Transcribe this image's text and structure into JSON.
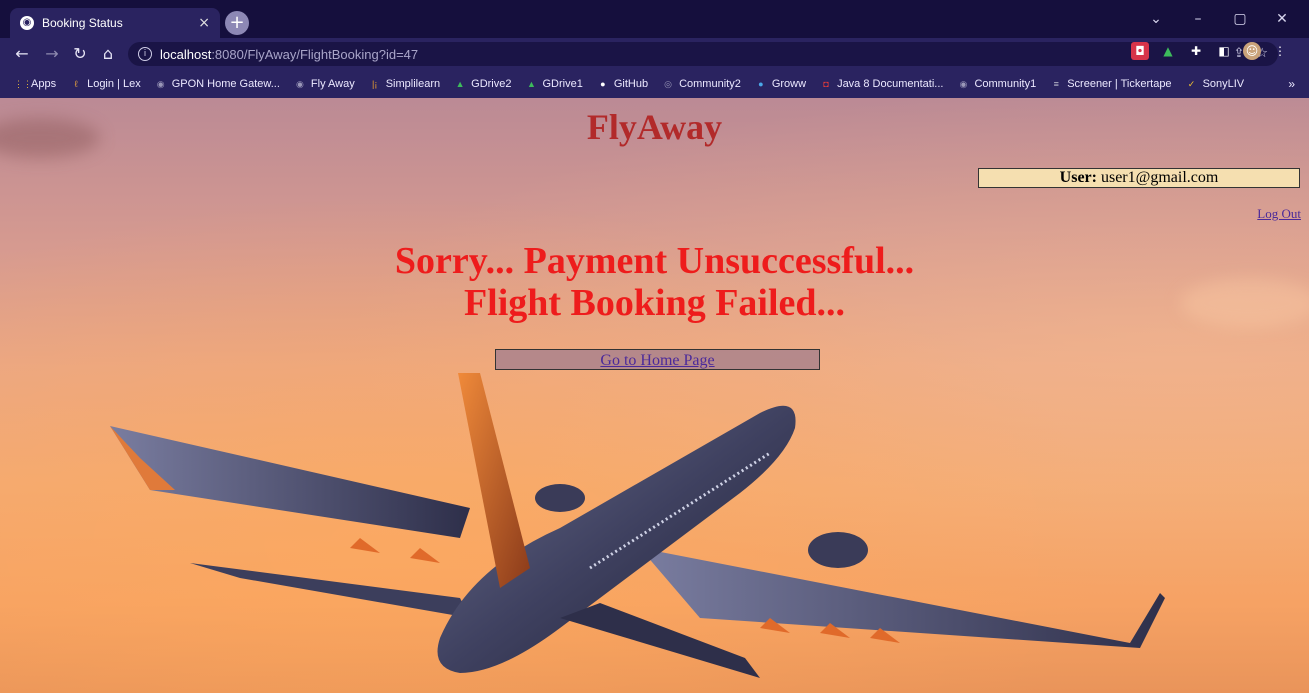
{
  "browser": {
    "tab_title": "Booking Status",
    "tab_close": "×",
    "new_tab": "+",
    "url_host": "localhost",
    "url_rest": ":8080/FlyAway/FlightBooking?id=47",
    "window_controls": [
      "⌄",
      "–",
      "▢",
      "✕"
    ],
    "bookmarks": [
      {
        "label": "Apps",
        "icon": "apps-grid-icon",
        "color": "#e8b93c"
      },
      {
        "label": "Login | Lex",
        "icon": "lex-icon",
        "color": "#e8a23c"
      },
      {
        "label": "GPON Home Gatew...",
        "icon": "globe-icon",
        "color": "#9a97b8"
      },
      {
        "label": "Fly Away",
        "icon": "globe-icon",
        "color": "#9a97b8"
      },
      {
        "label": "Simplilearn",
        "icon": "simplilearn-icon",
        "color": "#f0a02c"
      },
      {
        "label": "GDrive2",
        "icon": "gdrive-icon",
        "color": "#3dbb5c"
      },
      {
        "label": "GDrive1",
        "icon": "gdrive-icon",
        "color": "#3dbb5c"
      },
      {
        "label": "GitHub",
        "icon": "github-icon",
        "color": "#ffffff"
      },
      {
        "label": "Community2",
        "icon": "community-icon",
        "color": "#9a97b8"
      },
      {
        "label": "Groww",
        "icon": "groww-icon",
        "color": "#4aa8e8"
      },
      {
        "label": "Java 8 Documentati...",
        "icon": "java-doc-icon",
        "color": "#e03a3a"
      },
      {
        "label": "Community1",
        "icon": "globe-icon",
        "color": "#9a97b8"
      },
      {
        "label": "Screener | Tickertape",
        "icon": "tickertape-icon",
        "color": "#c0c0d0"
      },
      {
        "label": "SonyLIV",
        "icon": "sonyliv-icon",
        "color": "#f0c030"
      }
    ],
    "bookmarks_more": "»"
  },
  "page": {
    "site_title": "FlyAway",
    "user_label": "User:",
    "user_email": "user1@gmail.com",
    "logout": "Log Out",
    "message_line1": "Sorry... Payment Unsuccessful...",
    "message_line2": "Flight Booking Failed...",
    "home_link": "Go to Home Page"
  },
  "colors": {
    "title": "#b22a2a",
    "message": "#ee1c1c",
    "link": "#4b2a9a",
    "user_box_bg": "#f5dfb0"
  }
}
